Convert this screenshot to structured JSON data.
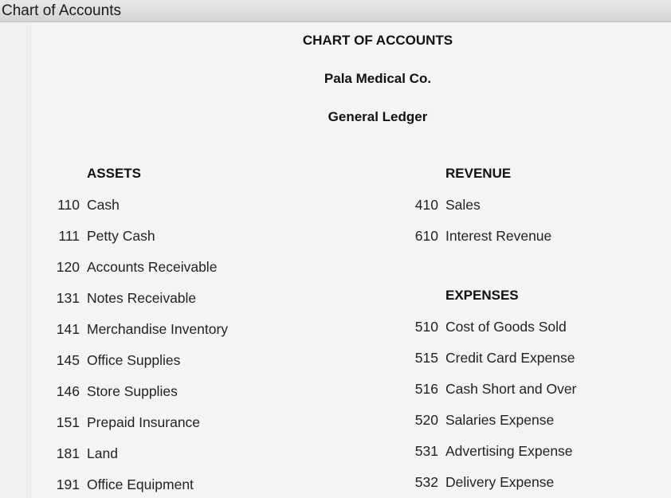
{
  "window": {
    "title": "Chart of Accounts"
  },
  "header": {
    "title": "CHART OF ACCOUNTS",
    "company": "Pala Medical Co.",
    "ledger": "General Ledger"
  },
  "assets": {
    "heading": "ASSETS",
    "items": [
      {
        "num": "110",
        "name": "Cash"
      },
      {
        "num": "111",
        "name": "Petty Cash"
      },
      {
        "num": "120",
        "name": "Accounts Receivable"
      },
      {
        "num": "131",
        "name": "Notes Receivable"
      },
      {
        "num": "141",
        "name": "Merchandise Inventory"
      },
      {
        "num": "145",
        "name": "Office Supplies"
      },
      {
        "num": "146",
        "name": "Store Supplies"
      },
      {
        "num": "151",
        "name": "Prepaid Insurance"
      },
      {
        "num": "181",
        "name": "Land"
      },
      {
        "num": "191",
        "name": "Office Equipment"
      }
    ]
  },
  "revenue": {
    "heading": "REVENUE",
    "items": [
      {
        "num": "410",
        "name": "Sales"
      },
      {
        "num": "610",
        "name": "Interest Revenue"
      }
    ]
  },
  "expenses": {
    "heading": "EXPENSES",
    "items": [
      {
        "num": "510",
        "name": "Cost of Goods Sold"
      },
      {
        "num": "515",
        "name": "Credit Card Expense"
      },
      {
        "num": "516",
        "name": "Cash Short and Over"
      },
      {
        "num": "520",
        "name": "Salaries Expense"
      },
      {
        "num": "531",
        "name": "Advertising Expense"
      },
      {
        "num": "532",
        "name": "Delivery Expense"
      }
    ]
  }
}
